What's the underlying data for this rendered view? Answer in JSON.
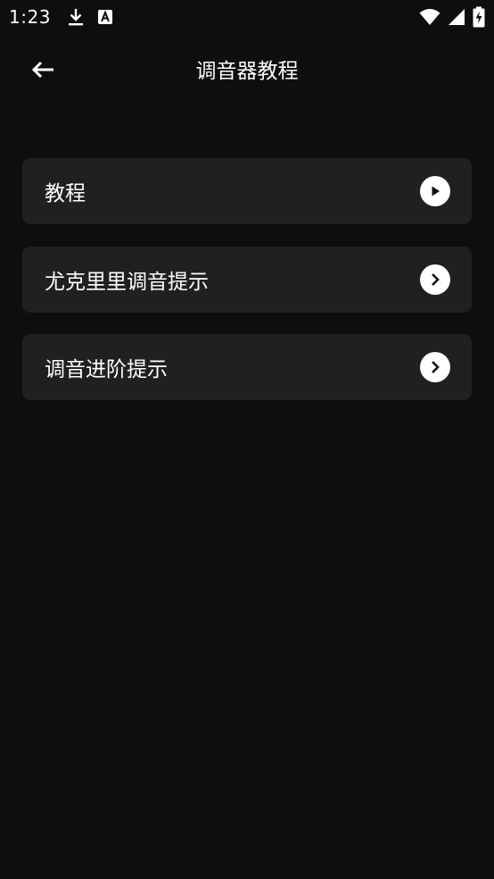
{
  "status_bar": {
    "time": "1:23",
    "left_icons": [
      "download-icon",
      "a-badge-icon"
    ],
    "right_icons": [
      "wifi-icon",
      "signal-icon",
      "battery-charging-icon"
    ]
  },
  "app_bar": {
    "back_icon": "arrow-left-icon",
    "title": "调音器教程"
  },
  "menu": {
    "items": [
      {
        "label": "教程",
        "icon": "play-circle-icon"
      },
      {
        "label": "尤克里里调音提示",
        "icon": "chevron-right-circle-icon"
      },
      {
        "label": "调音进阶提示",
        "icon": "chevron-right-circle-icon"
      }
    ]
  },
  "colors": {
    "background": "#0e0e0e",
    "card": "#202020",
    "text": "#ffffff"
  }
}
